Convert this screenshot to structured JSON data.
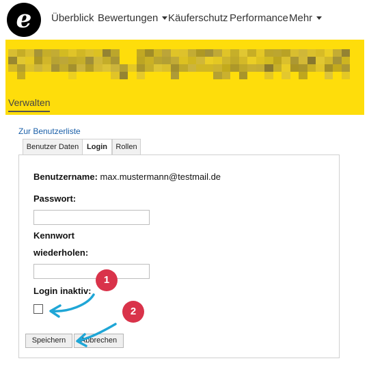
{
  "nav": {
    "logo_letter": "e",
    "items": [
      {
        "label": "Überblick",
        "has_dropdown": false
      },
      {
        "label": "Bewertungen",
        "has_dropdown": true
      },
      {
        "label": "Käuferschutz",
        "has_dropdown": false
      },
      {
        "label": "Performance",
        "has_dropdown": false
      },
      {
        "label": "Mehr",
        "has_dropdown": true
      }
    ]
  },
  "banner": {
    "shop_name_pixelated": true,
    "background_color": "#fedd0b",
    "tab_label": "Verwalten"
  },
  "back_link": "Zur Benutzerliste",
  "tabs": [
    "Benutzer Daten",
    "Login",
    "Rollen"
  ],
  "active_tab": "Login",
  "form": {
    "username_label": "Benutzername:",
    "username_value": "max.mustermann@testmail.de",
    "password_label": "Passwort:",
    "password_value": "",
    "repeat_label_line1": "Kennwort",
    "repeat_label_line2": "wiederholen:",
    "repeat_value": "",
    "inactive_label": "Login inaktiv:",
    "inactive_checked": false
  },
  "buttons": {
    "save": "Speichern",
    "cancel": "Abbrechen"
  },
  "annotations": {
    "badge_1": "1",
    "badge_2": "2",
    "badge_color": "#d9334a",
    "arrow_color": "#1fa6d6"
  }
}
